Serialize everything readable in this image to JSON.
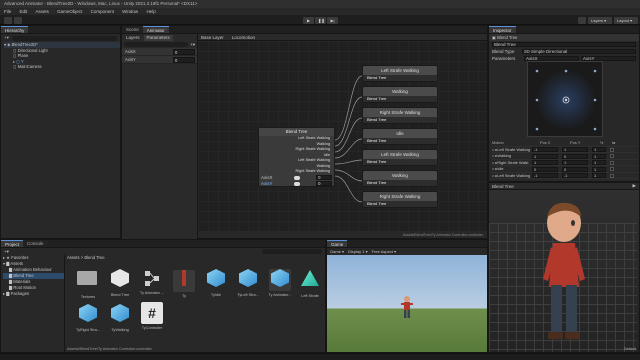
{
  "window": {
    "title": "Advanced Animator - BlendTree2D - Windows, Mac, Linux - Unity 2021.3.19f1 Personal* <DX11>"
  },
  "menu": [
    "File",
    "Edit",
    "Assets",
    "GameObject",
    "Component",
    "Window",
    "Help"
  ],
  "toolbar": {
    "layers": "Layers",
    "layout": "Layout"
  },
  "hierarchy": {
    "tab": "Hierarchy",
    "items": [
      "BlendTree2D*",
      "Directional Light",
      "Plane",
      "Y",
      "MainCamera"
    ]
  },
  "animator": {
    "tabs": [
      "Scene",
      "Animator"
    ],
    "left_tabs": [
      "Layers",
      "Parameters"
    ],
    "params": [
      {
        "name": "AxisX",
        "value": "0"
      },
      {
        "name": "AxisY",
        "value": "0"
      }
    ],
    "breadcrumb": [
      "Base Layer",
      "Locomotion"
    ],
    "blend_tree": {
      "title": "Blend Tree",
      "lines": [
        "Left Strafe Walking",
        "Walking",
        "Right Strafe Walking",
        "Idle",
        "Left Strafe Walking",
        "Walking",
        "Right Strafe Walking"
      ],
      "param_x": "AxisX",
      "param_y": "AxisY",
      "value_x": "0",
      "value_y": "0"
    },
    "motions": [
      {
        "name": "Left Strafe Walking",
        "sub": "Blend Tree"
      },
      {
        "name": "Walking",
        "sub": "Blend Tree"
      },
      {
        "name": "Right Strafe Walking",
        "sub": "Blend Tree"
      },
      {
        "name": "Idle",
        "sub": "Blend Tree"
      },
      {
        "name": "Left Strafe Walking",
        "sub": "Blend Tree"
      },
      {
        "name": "Walking",
        "sub": "Blend Tree"
      },
      {
        "name": "Right Strafe Walking",
        "sub": "Blend Tree"
      }
    ],
    "footer": "Assets/BlendTree/Ty Animator Controller.controller"
  },
  "inspector": {
    "tab": "Inspector",
    "object": "Blend Tree",
    "name": "Blend Tree",
    "blend_type_label": "Blend Type",
    "blend_type": "2D Simple Directional",
    "parameters_label": "Parameters",
    "param_x": "AxisX",
    "param_y": "AxisY",
    "motion_header": [
      "Motion",
      "Pos X",
      "Pos Y",
      "½",
      "⇆"
    ],
    "motions": [
      {
        "name": "Left Strafe Walking",
        "x": "-1",
        "y": "1",
        "s": "1"
      },
      {
        "name": "Walking",
        "x": "1",
        "y": "0",
        "s": "1"
      },
      {
        "name": "Right Strafe Walki",
        "x": "1",
        "y": "1",
        "s": "1"
      },
      {
        "name": "Idle",
        "x": "0",
        "y": "0",
        "s": "1"
      },
      {
        "name": "Left Strafe Walking",
        "x": "-1",
        "y": "-1",
        "s": "1"
      }
    ],
    "preview_title": "Blend Tree",
    "preview_label": "Default"
  },
  "project": {
    "tabs": [
      "Project",
      "Console"
    ],
    "tree": [
      "Favorites",
      "Assets",
      "Animation Behaviour",
      "Blend Tree",
      "Materials",
      "Root Motion",
      "Packages"
    ],
    "breadcrumb": "Assets > Blend Tree",
    "assets": [
      {
        "name": "Textures",
        "kind": "folder"
      },
      {
        "name": "Blend Tree",
        "kind": "unity"
      },
      {
        "name": "Ty Animator ...",
        "kind": "controller"
      },
      {
        "name": "Ty",
        "kind": "model"
      },
      {
        "name": "TyIdle",
        "kind": "cube"
      },
      {
        "name": "TyLeft Stra...",
        "kind": "cube"
      },
      {
        "name": "Ty Animator...",
        "kind": "cube"
      },
      {
        "name": "Left Strafe",
        "kind": "triangle"
      },
      {
        "name": "TyRight Stra...",
        "kind": "cube"
      },
      {
        "name": "TyWalking",
        "kind": "cube"
      },
      {
        "name": "TyController",
        "kind": "script"
      }
    ],
    "footer": "Assets/BlendTree/Ty Animator Controller.controller"
  },
  "game": {
    "tab": "Game",
    "game_dd": "Game",
    "display": "Display 1",
    "aspect": "Free Aspect"
  },
  "colors": {
    "accent": "#5c8fd6",
    "selection": "#2c5d87"
  }
}
